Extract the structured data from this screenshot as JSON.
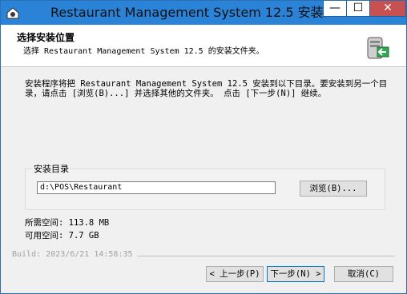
{
  "window": {
    "title": "Restaurant Management System 12.5 安装",
    "minimize_label": "—",
    "maximize_label": "☐",
    "close_label": "✕"
  },
  "header": {
    "title": "选择安装位置",
    "subtitle": "选择 Restaurant Management System 12.5 的安装文件夹。",
    "icon": "installer-computer-icon"
  },
  "body_text": "安装程序将把 Restaurant Management System 12.5 安装到以下目录。要安装到另一个目录，请点击 [浏览(B)...] 并选择其他的文件夹。 点击 [下一步(N)] 继续。",
  "install_dir": {
    "label": "安装目录",
    "value": "d:\\POS\\Restaurant",
    "browse_label": "浏览(B)..."
  },
  "space": {
    "required": "所需空间: 113.8 MB",
    "available": "可用空间: 7.7 GB"
  },
  "build": "Build: 2023/6/21 14:58:35",
  "buttons": {
    "back": "< 上一步(P)",
    "next": "下一步(N) >",
    "cancel": "取消(C)"
  }
}
